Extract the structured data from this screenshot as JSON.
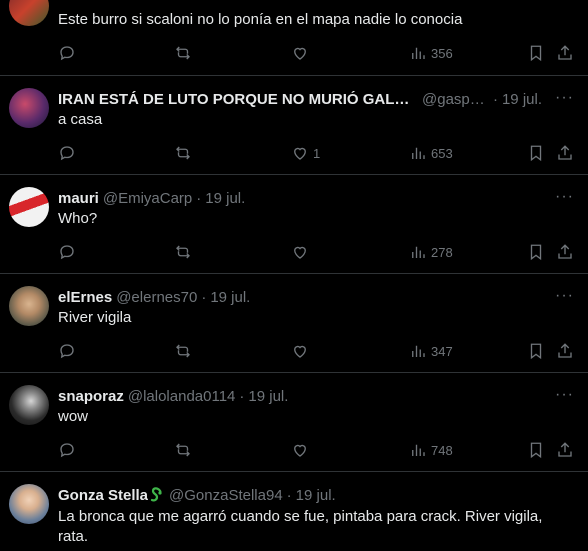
{
  "tweets": [
    {
      "name": "",
      "handle": "",
      "date": "",
      "text": "Este burro si scaloni no lo ponía en el mapa nadie lo conocia",
      "replies": "",
      "retweets": "",
      "likes": "",
      "views": "356"
    },
    {
      "name": "IRAN ESTÁ DE LUTO PORQUE NO MURIÓ GALLA...",
      "handle": "@gaspo...",
      "date": "19 jul.",
      "text": "a casa",
      "replies": "",
      "retweets": "",
      "likes": "1",
      "views": "653"
    },
    {
      "name": "mauri",
      "handle": "@EmiyaCarp",
      "date": "19 jul.",
      "text": "Who?",
      "replies": "",
      "retweets": "",
      "likes": "",
      "views": "278"
    },
    {
      "name": "elErnes",
      "handle": "@elernes70",
      "date": "19 jul.",
      "text": "River vigila",
      "replies": "",
      "retweets": "",
      "likes": "",
      "views": "347"
    },
    {
      "name": "snaporaz",
      "handle": "@lalolanda0114",
      "date": "19 jul.",
      "text": "wow",
      "replies": "",
      "retweets": "",
      "likes": "",
      "views": "748"
    },
    {
      "name": "Gonza Stella",
      "handle": "@GonzaStella94",
      "date": "19 jul.",
      "text": "La bronca que me agarró cuando se fue, pintaba para crack. River vigila, rata.",
      "replies": "",
      "retweets": "",
      "likes": "",
      "views": ""
    }
  ],
  "icons": {
    "reply": "reply-icon",
    "retweet": "retweet-icon",
    "like": "heart-icon",
    "views": "views-icon",
    "bookmark": "bookmark-icon",
    "share": "share-icon",
    "more": "more-icon"
  },
  "colors": {
    "background": "#000000",
    "text": "#e7e9ea",
    "muted": "#71767b",
    "divider": "#2f3336",
    "verified_badge": "#3fb54a"
  },
  "more_glyph": "···",
  "separator": "·"
}
